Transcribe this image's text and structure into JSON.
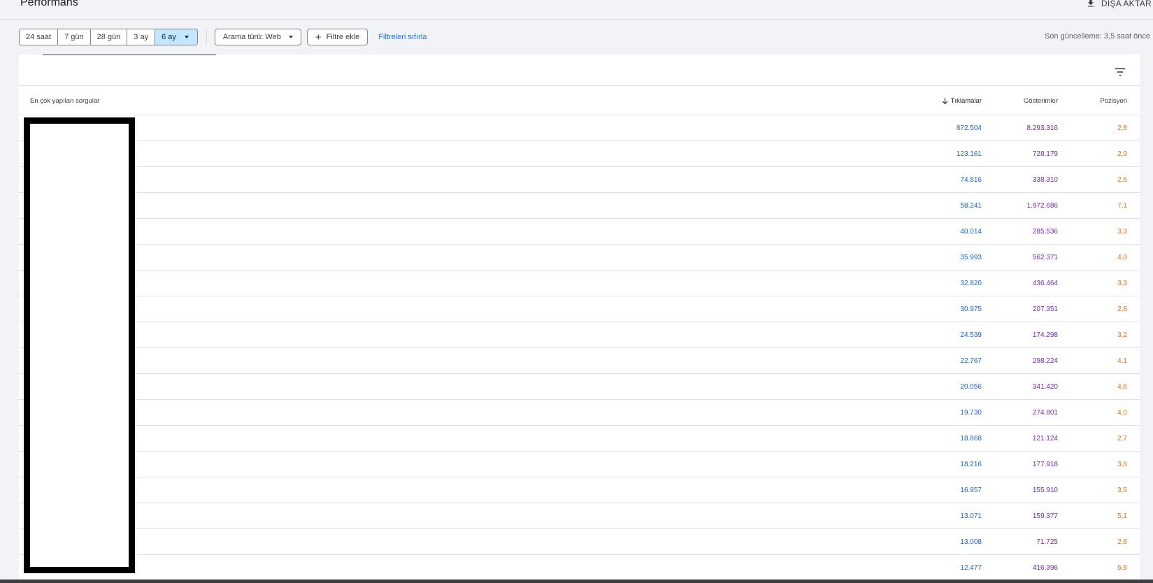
{
  "header": {
    "title": "Performans",
    "export_label": "DIŞA AKTAR"
  },
  "toolbar": {
    "date_ranges": [
      "24 saat",
      "7 gün",
      "28 gün",
      "3 ay",
      "6 ay"
    ],
    "active_range": "6 ay",
    "search_type": "Arama türü: Web",
    "add_filter": "Filtre ekle",
    "reset_filters": "Filtreleri sıfırla",
    "last_updated": "Son güncelleme: 3,5 saat önce"
  },
  "table": {
    "columns": {
      "query": "En çok yapılan sorgular",
      "clicks": "Tıklamalar",
      "impressions": "Gösterimler",
      "position": "Pozisyon"
    },
    "sort": {
      "column": "clicks",
      "direction": "descending"
    },
    "rows": [
      {
        "clicks": "872.504",
        "impressions": "8.293.316",
        "position": "2,8"
      },
      {
        "clicks": "123.161",
        "impressions": "728.179",
        "position": "2,9"
      },
      {
        "clicks": "74.816",
        "impressions": "338.310",
        "position": "2,6"
      },
      {
        "clicks": "58.241",
        "impressions": "1.972.686",
        "position": "7,1"
      },
      {
        "clicks": "40.014",
        "impressions": "285.536",
        "position": "3,3"
      },
      {
        "clicks": "35.993",
        "impressions": "562.371",
        "position": "4,0"
      },
      {
        "clicks": "32.820",
        "impressions": "436.464",
        "position": "3,3"
      },
      {
        "clicks": "30.975",
        "impressions": "207.351",
        "position": "2,8"
      },
      {
        "clicks": "24.539",
        "impressions": "174.298",
        "position": "3,2"
      },
      {
        "clicks": "22.767",
        "impressions": "298.224",
        "position": "4,1"
      },
      {
        "clicks": "20.056",
        "impressions": "341.420",
        "position": "4,6"
      },
      {
        "clicks": "19.730",
        "impressions": "274.801",
        "position": "4,0"
      },
      {
        "clicks": "18.868",
        "impressions": "121.124",
        "position": "2,7"
      },
      {
        "clicks": "18.216",
        "impressions": "177.918",
        "position": "3,6"
      },
      {
        "clicks": "16.957",
        "impressions": "155.910",
        "position": "3,5"
      },
      {
        "clicks": "13.071",
        "impressions": "159.377",
        "position": "5,1"
      },
      {
        "clicks": "13.008",
        "impressions": "71.725",
        "position": "2,8"
      },
      {
        "clicks": "12.477",
        "impressions": "416.396",
        "position": "6,8"
      }
    ]
  },
  "colors": {
    "clicks": "#1967d2",
    "impressions": "#7627bb",
    "position": "#e8710a",
    "active_chip": "#c2e7ff",
    "link": "#1a73e8"
  },
  "icons": [
    "download-icon",
    "filter-list-icon",
    "arrow-down-icon",
    "plus-icon",
    "dropdown-caret-icon"
  ]
}
